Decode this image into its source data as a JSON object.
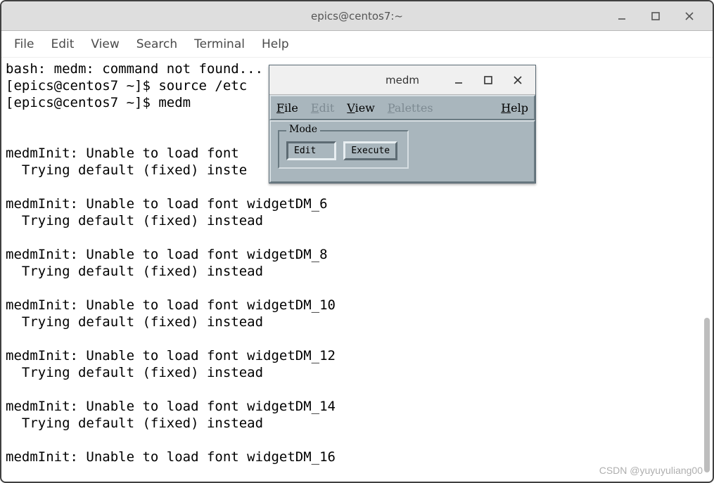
{
  "terminal_window": {
    "title": "epics@centos7:~",
    "menubar": [
      "File",
      "Edit",
      "View",
      "Search",
      "Terminal",
      "Help"
    ],
    "lines": [
      "bash: medm: command not found...",
      "[epics@centos7 ~]$ source /etc",
      "[epics@centos7 ~]$ medm",
      "",
      "",
      "medmInit: Unable to load font ",
      "  Trying default (fixed) inste",
      "",
      "medmInit: Unable to load font widgetDM_6",
      "  Trying default (fixed) instead",
      "",
      "medmInit: Unable to load font widgetDM_8",
      "  Trying default (fixed) instead",
      "",
      "medmInit: Unable to load font widgetDM_10",
      "  Trying default (fixed) instead",
      "",
      "medmInit: Unable to load font widgetDM_12",
      "  Trying default (fixed) instead",
      "",
      "medmInit: Unable to load font widgetDM_14",
      "  Trying default (fixed) instead",
      "",
      "medmInit: Unable to load font widgetDM_16"
    ]
  },
  "medm_window": {
    "title": "medm",
    "menubar": {
      "file": "File",
      "edit": "Edit",
      "view": "View",
      "palettes": "Palettes",
      "help": "Help"
    },
    "mode_label": "Mode",
    "mode_buttons": {
      "edit": "Edit",
      "execute": "Execute"
    },
    "mode_selected": "edit"
  },
  "watermark": "CSDN @yuyuyuliang00"
}
